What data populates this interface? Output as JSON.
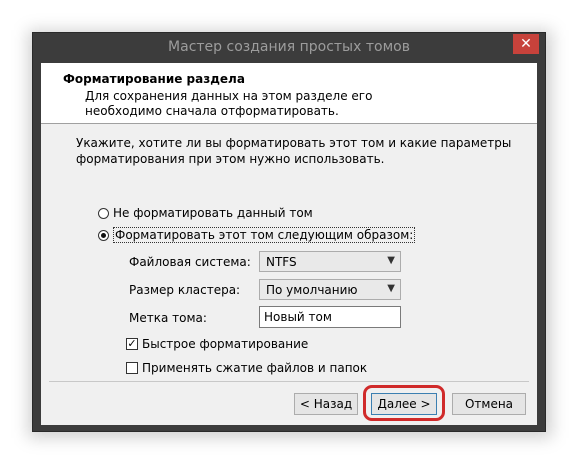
{
  "window": {
    "title": "Мастер создания простых томов",
    "close_glyph": "✕"
  },
  "header": {
    "title": "Форматирование раздела",
    "description": "Для сохранения данных на этом разделе его необходимо сначала отформатировать."
  },
  "body": {
    "instruction": "Укажите, хотите ли вы форматировать этот том и какие параметры форматирования при этом нужно использовать."
  },
  "options": {
    "no_format": {
      "label": "Не форматировать данный том",
      "selected": false
    },
    "format": {
      "label": "Форматировать этот том следующим образом:",
      "selected": true
    }
  },
  "fields": {
    "filesystem": {
      "label": "Файловая система:",
      "value": "NTFS"
    },
    "cluster": {
      "label": "Размер кластера:",
      "value": "По умолчанию"
    },
    "volume_label": {
      "label": "Метка тома:",
      "value": "Новый том"
    }
  },
  "checkboxes": {
    "quick_format": {
      "label": "Быстрое форматирование",
      "checked": true,
      "mark": "✓"
    },
    "compression": {
      "label": "Применять сжатие файлов и папок",
      "checked": false
    }
  },
  "buttons": {
    "back": "< Назад",
    "next": "Далее >",
    "cancel": "Отмена"
  },
  "colors": {
    "close_button": "#c7423b",
    "highlight_ring": "#d02a2a",
    "default_button_border": "#3c7fb1"
  }
}
